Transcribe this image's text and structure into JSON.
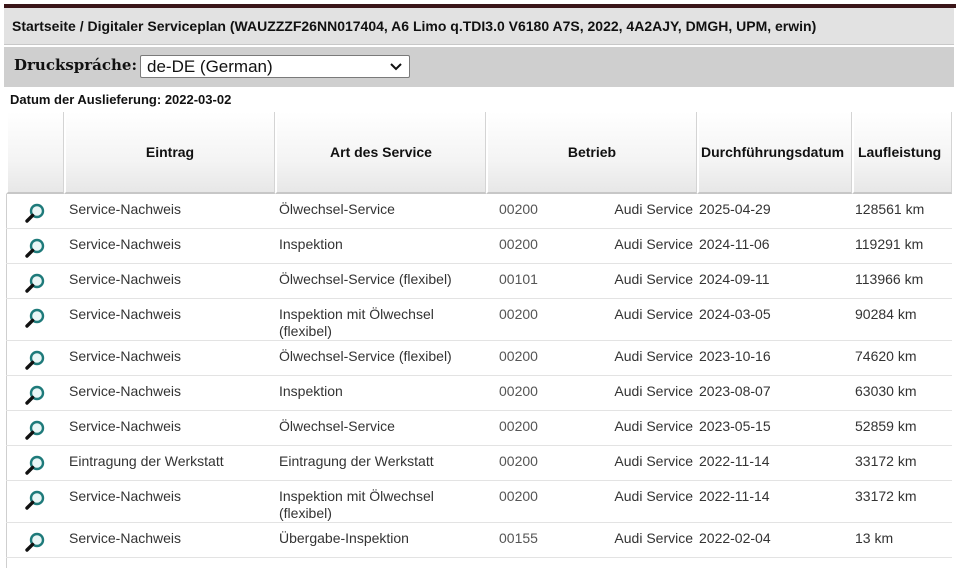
{
  "breadcrumb": "Startseite / Digitaler Serviceplan (WAUZZZF26NN017404, A6 Limo q.TDI3.0 V6180 A7S, 2022, 4A2AJY, DMGH, UPM, erwin)",
  "print_language": {
    "label": "Druckspráche:",
    "selected": "de-DE (German)"
  },
  "delivery_date": "Datum der Auslieferung: 2022-03-02",
  "table": {
    "headers": {
      "icon": "",
      "entry": "Eintrag",
      "art": "Art des Service",
      "betrieb": "Betrieb",
      "date": "Durchführungsdatum",
      "mileage": "Laufleistung"
    },
    "rows": [
      {
        "entry": "Service-Nachweis",
        "art": "Ölwechsel-Service",
        "code": "00200",
        "betrieb": "Audi Service",
        "date": "2025-04-29",
        "km": "128561 km"
      },
      {
        "entry": "Service-Nachweis",
        "art": "Inspektion",
        "code": "00200",
        "betrieb": "Audi Service",
        "date": "2024-11-06",
        "km": "119291 km"
      },
      {
        "entry": "Service-Nachweis",
        "art": "Ölwechsel-Service (flexibel)",
        "code": "00101",
        "betrieb": "Audi Service",
        "date": "2024-09-11",
        "km": "113966 km"
      },
      {
        "entry": "Service-Nachweis",
        "art": "Inspektion mit Ölwechsel (flexibel)",
        "code": "00200",
        "betrieb": "Audi Service",
        "date": "2024-03-05",
        "km": "90284 km"
      },
      {
        "entry": "Service-Nachweis",
        "art": "Ölwechsel-Service (flexibel)",
        "code": "00200",
        "betrieb": "Audi Service",
        "date": "2023-10-16",
        "km": "74620 km"
      },
      {
        "entry": "Service-Nachweis",
        "art": "Inspektion",
        "code": "00200",
        "betrieb": "Audi Service",
        "date": "2023-08-07",
        "km": "63030 km"
      },
      {
        "entry": "Service-Nachweis",
        "art": "Ölwechsel-Service",
        "code": "00200",
        "betrieb": "Audi Service",
        "date": "2023-05-15",
        "km": "52859 km"
      },
      {
        "entry": "Eintragung der Werkstatt",
        "art": "Eintragung der Werkstatt",
        "code": "00200",
        "betrieb": "Audi Service",
        "date": "2022-11-14",
        "km": "33172 km"
      },
      {
        "entry": "Service-Nachweis",
        "art": "Inspektion mit Ölwechsel (flexibel)",
        "code": "00200",
        "betrieb": "Audi Service",
        "date": "2022-11-14",
        "km": "33172 km"
      },
      {
        "entry": "Service-Nachweis",
        "art": "Übergabe-Inspektion",
        "code": "00155",
        "betrieb": "Audi Service",
        "date": "2022-02-04",
        "km": "13 km"
      }
    ]
  },
  "icons": {
    "row_action": "magnifier-icon",
    "select_arrow": "chevron-down-icon"
  },
  "colors": {
    "breadcrumb_bg": "#e2e2e2",
    "printbar_bg": "#cfcfcf",
    "magnifier": "#1e7a7a",
    "top_rule": "#3a1518"
  }
}
